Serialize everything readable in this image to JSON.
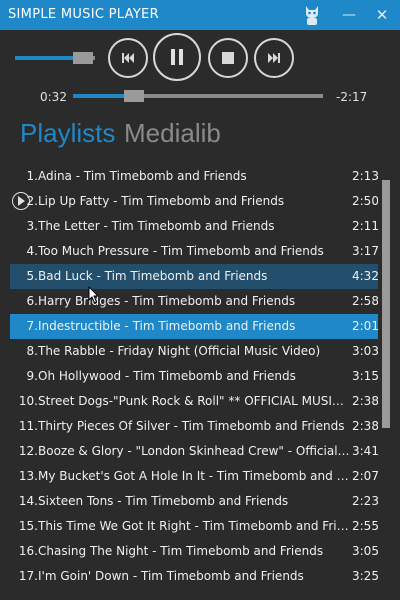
{
  "app": {
    "title": "SIMPLE MUSIC PLAYER"
  },
  "window": {
    "minimize_glyph": "—",
    "close_glyph": "✕"
  },
  "player": {
    "volume_level": 0.85,
    "elapsed": "0:32",
    "remaining": "-2:17",
    "progress": 0.22,
    "state": "playing"
  },
  "tabs": [
    {
      "label": "Playlists",
      "active": true
    },
    {
      "label": "Medialib",
      "active": false
    }
  ],
  "playlist": [
    {
      "num": "1.",
      "title": "Adina - Tim Timebomb and Friends",
      "duration": "2:13"
    },
    {
      "num": "2.",
      "title": "Lip Up Fatty - Tim Timebomb and Friends",
      "duration": "2:50",
      "playing": true
    },
    {
      "num": "3.",
      "title": "The Letter - Tim Timebomb and Friends",
      "duration": "2:11"
    },
    {
      "num": "4.",
      "title": "Too Much Pressure - Tim Timebomb and Friends",
      "duration": "3:17"
    },
    {
      "num": "5.",
      "title": "Bad Luck - Tim Timebomb and Friends",
      "duration": "4:32",
      "hover": true
    },
    {
      "num": "6.",
      "title": "Harry Bridges - Tim Timebomb and Friends",
      "duration": "2:58"
    },
    {
      "num": "7.",
      "title": "Indestructible - Tim Timebomb and Friends",
      "duration": "2:01",
      "selected": true
    },
    {
      "num": "8.",
      "title": "The Rabble - Friday Night (Official Music Video)",
      "duration": "3:03"
    },
    {
      "num": "9.",
      "title": "Oh Hollywood - Tim Timebomb and Friends",
      "duration": "3:15"
    },
    {
      "num": "10.",
      "title": "Street Dogs-\"Punk Rock & Roll\" ** OFFICIAL MUSIC VI...",
      "duration": "2:38"
    },
    {
      "num": "11.",
      "title": "Thirty Pieces Of Silver - Tim Timebomb and Friends",
      "duration": "2:38"
    },
    {
      "num": "12.",
      "title": "Booze & Glory - \"London Skinhead Crew\" - Official Vi...",
      "duration": "3:41"
    },
    {
      "num": "13.",
      "title": "My Bucket's Got A Hole In It - Tim Timebomb and Fri...",
      "duration": "2:07"
    },
    {
      "num": "14.",
      "title": "Sixteen Tons - Tim Timebomb and Friends",
      "duration": "2:23"
    },
    {
      "num": "15.",
      "title": "This Time We Got It Right - Tim Timebomb and Friends",
      "duration": "2:55"
    },
    {
      "num": "16.",
      "title": "Chasing The Night - Tim Timebomb and Friends",
      "duration": "3:05"
    },
    {
      "num": "17.",
      "title": "I'm Goin' Down - Tim Timebomb and Friends",
      "duration": "3:25"
    }
  ]
}
